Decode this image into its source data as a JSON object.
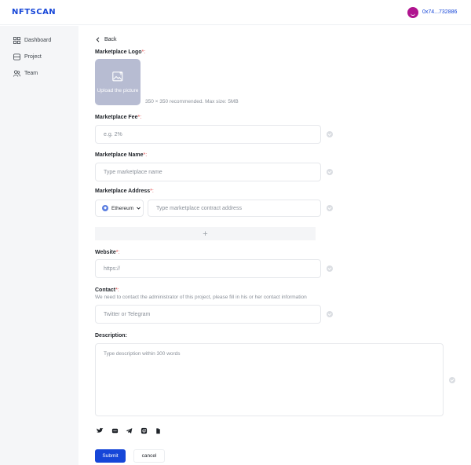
{
  "header": {
    "logo": "NFTSCAN",
    "wallet_address": "0x74...732886"
  },
  "sidebar": {
    "items": [
      {
        "label": "Dashboard",
        "icon": "dashboard-icon"
      },
      {
        "label": "Project",
        "icon": "project-icon"
      },
      {
        "label": "Team",
        "icon": "team-icon"
      }
    ]
  },
  "form": {
    "back_label": "Back",
    "logo": {
      "label": "Marketplace Logo",
      "required_mark": "*:",
      "upload_text": "Upload the picture",
      "hint": "350 × 350 recommended. Max size: 5MB"
    },
    "fee": {
      "label": "Marketplace Fee",
      "required_mark": "*:",
      "placeholder": "e.g. 2%"
    },
    "name": {
      "label": "Marketplace Name",
      "required_mark": "*:",
      "placeholder": "Type marketplace name"
    },
    "address": {
      "label": "Marketplace Address",
      "required_mark": "*:",
      "chain": "Ethereum",
      "placeholder": "Type  marketplace contract address",
      "add_symbol": "+"
    },
    "website": {
      "label": "Website",
      "required_mark": "*:",
      "placeholder": "https://"
    },
    "contact": {
      "label": "Contact",
      "required_mark": "*:",
      "hint": "We need to contact the administrator of this project, please fill in his or her contact information",
      "placeholder": "Twitter or Telegram"
    },
    "description": {
      "label": "Description:",
      "placeholder": "Type description within 300 words"
    },
    "social_icons": [
      "twitter-icon",
      "discord-icon",
      "telegram-icon",
      "instagram-icon",
      "medium-icon"
    ],
    "submit_label": "Submit",
    "cancel_label": "cancel"
  },
  "colors": {
    "brand": "#1646d8",
    "required": "#e24a4a",
    "upload_bg": "#b7bcd2",
    "sidebar_bg": "#f5f6f8"
  }
}
